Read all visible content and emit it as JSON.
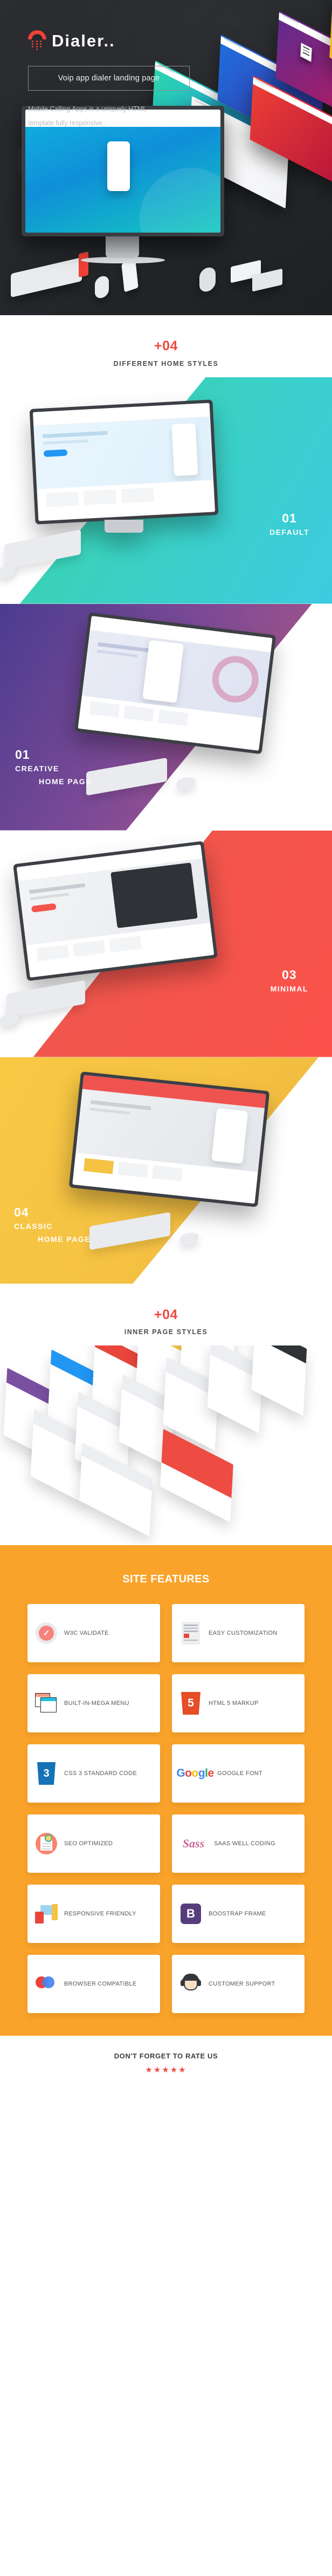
{
  "hero": {
    "logo_text": "Dialer..",
    "logo_icon": "dial-phone-icon",
    "ghost_text": "Dialer..",
    "tagline": "Voip app dialer landing page",
    "description": "Mobile Calling Apps is a uniquely HTML template fully responsive ."
  },
  "home_styles_section": {
    "count_label": "+04",
    "subtitle": "DIFFERENT HOME STYLES",
    "accent_color": "#ee4b43"
  },
  "showcases": [
    {
      "number": "01",
      "name": "DEFAULT",
      "name2": "",
      "bg_color": "#38d39f"
    },
    {
      "number": "01",
      "name": "CREATIVE",
      "name2": "HOME PAGE",
      "bg_color": "#7c4a96"
    },
    {
      "number": "03",
      "name": "MINIMAL",
      "name2": "",
      "bg_color": "#f2554c"
    },
    {
      "number": "04",
      "name": "CLASSIC",
      "name2": "HOME PAGE",
      "bg_color": "#f5c243"
    }
  ],
  "inner_pages_section": {
    "count_label": "+04",
    "subtitle": "INNER PAGE STYLES"
  },
  "features": {
    "title": "SITE FEATURES",
    "bg_color": "#f9a32a",
    "items": [
      {
        "label": "W3C VALIDATE",
        "icon": "check-circle-icon"
      },
      {
        "label": "EASY CUSTOMIZATION",
        "icon": "document-icon"
      },
      {
        "label": "BUILT-IN-MEGA MENU",
        "icon": "windows-menu-icon"
      },
      {
        "label": "HTML 5 MARKUP",
        "icon": "html5-shield-icon"
      },
      {
        "label": "CSS 3 STANDARD CODE",
        "icon": "css3-shield-icon"
      },
      {
        "label": "GOOGLE FONT",
        "icon": "google-logo-icon"
      },
      {
        "label": "SEO OPTIMIZED",
        "icon": "seo-magnifier-icon"
      },
      {
        "label": "SAAS WELL CODING",
        "icon": "sass-logo-icon"
      },
      {
        "label": "RESPONSIVE FRIENDLY",
        "icon": "responsive-devices-icon"
      },
      {
        "label": "BOOSTRAP FRAME",
        "icon": "bootstrap-logo-icon"
      },
      {
        "label": "BROWSER COMPATIBLE",
        "icon": "browser-circles-icon"
      },
      {
        "label": "CUSTOMER SUPPORT",
        "icon": "headset-person-icon"
      }
    ]
  },
  "footer": {
    "text": "DON'T FORGET TO RATE US",
    "stars": "★★★★★",
    "star_color": "#ee4b43"
  },
  "icons": {
    "html5": "5",
    "css3": "3",
    "bootstrap": "B",
    "sass": "Sass",
    "check": "✓"
  }
}
